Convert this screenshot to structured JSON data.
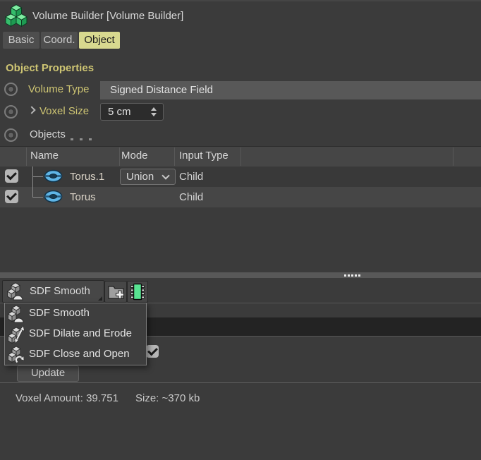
{
  "window": {
    "title": "Volume Builder [Volume Builder]"
  },
  "tabs": {
    "basic": "Basic",
    "coord": "Coord.",
    "object": "Object"
  },
  "section": {
    "title": "Object Properties"
  },
  "props": {
    "volume_type_label": "Volume Type",
    "volume_type_value": "Signed Distance Field",
    "voxel_size_label": "Voxel Size",
    "voxel_size_value": "5 cm",
    "objects_label": "Objects"
  },
  "table": {
    "headers": {
      "name": "Name",
      "mode": "Mode",
      "input_type": "Input Type"
    },
    "rows": [
      {
        "checked": true,
        "name": "Torus.1",
        "mode": "Union",
        "input_type": "Child"
      },
      {
        "checked": true,
        "name": "Torus",
        "input_type": "Child"
      }
    ]
  },
  "sdf": {
    "selected": "SDF Smooth",
    "menu": [
      "SDF Smooth",
      "SDF Dilate and Erode",
      "SDF Close and Open"
    ]
  },
  "buttons": {
    "update": "Update"
  },
  "status": {
    "voxel_amount": "Voxel Amount: 39.751",
    "size": "Size: ~370 kb"
  },
  "colors": {
    "panel_bg": "#3b3b3b",
    "accent_label_yellow": "#cec573",
    "tab_active_bg": "#d8d98f",
    "volume_icon_green": "#58e492",
    "torus_blue": "#5fb5e6",
    "dark_list_bar": "#232323"
  }
}
